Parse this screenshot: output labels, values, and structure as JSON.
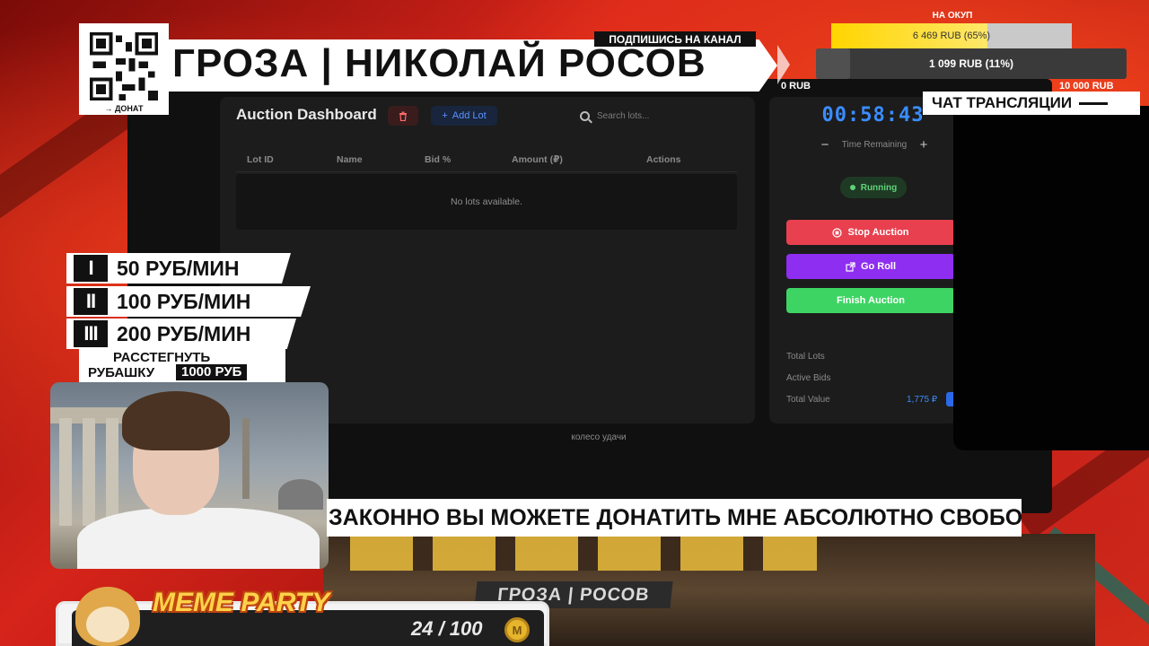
{
  "overlay": {
    "title": "ГРОЗА | НИКОЛАЙ РОСОВ",
    "subscribe": "ПОДПИШИСЬ НА КАНАЛ",
    "qr_label": "→ ДОНАТ",
    "chat_label": "ЧАТ ТРАНСЛЯЦИИ",
    "subtitle": "ЗАКОННО ВЫ МОЖЕТЕ ДОНАТИТЬ МНЕ АБСОЛЮТНО СВОБО",
    "brand_sub": "ГРОЗА | РОСОВ"
  },
  "goal": {
    "title": "НА ОКУП",
    "primary_text": "6 469 RUB (65%)",
    "primary_fraction": 0.65,
    "secondary_text": "1 099 RUB (11%)",
    "secondary_fraction": 0.11,
    "min_label": "0 RUB",
    "max_label": "10 000 RUB"
  },
  "prices": [
    {
      "roman": "I",
      "text": "50 РУБ/МИН"
    },
    {
      "roman": "II",
      "text": "100 РУБ/МИН"
    },
    {
      "roman": "III",
      "text": "200 РУБ/МИН"
    }
  ],
  "shirt": {
    "line1": "РАССТЕГНУТЬ",
    "line2": "РУБАШКУ",
    "price": "1000 РУБ"
  },
  "dashboard": {
    "title": "Auction Dashboard",
    "add_label": "Add Lot",
    "search_placeholder": "Search lots...",
    "columns": [
      "Lot ID",
      "Name",
      "Bid %",
      "Amount (₽)",
      "Actions"
    ],
    "empty": "No lots available.",
    "footer": "колесо удачи"
  },
  "side": {
    "timer": "00:58:43",
    "time_label": "Time Remaining",
    "minus": "−",
    "plus": "+",
    "status": "Running",
    "stop_label": "Stop Auction",
    "roll_label": "Go Roll",
    "finish_label": "Finish Auction",
    "stats": [
      {
        "label": "Total Lots",
        "value": ""
      },
      {
        "label": "Active Bids",
        "value": ""
      },
      {
        "label": "Total Value",
        "value": "1,775 ₽"
      }
    ]
  },
  "meme": {
    "title": "MEME PARTY",
    "count": "24 / 100",
    "coin_glyph": "M"
  },
  "colors": {
    "stop": "#e8404f",
    "roll": "#8e2ef0",
    "finish": "#3ed464",
    "accent": "#3a8dff"
  }
}
